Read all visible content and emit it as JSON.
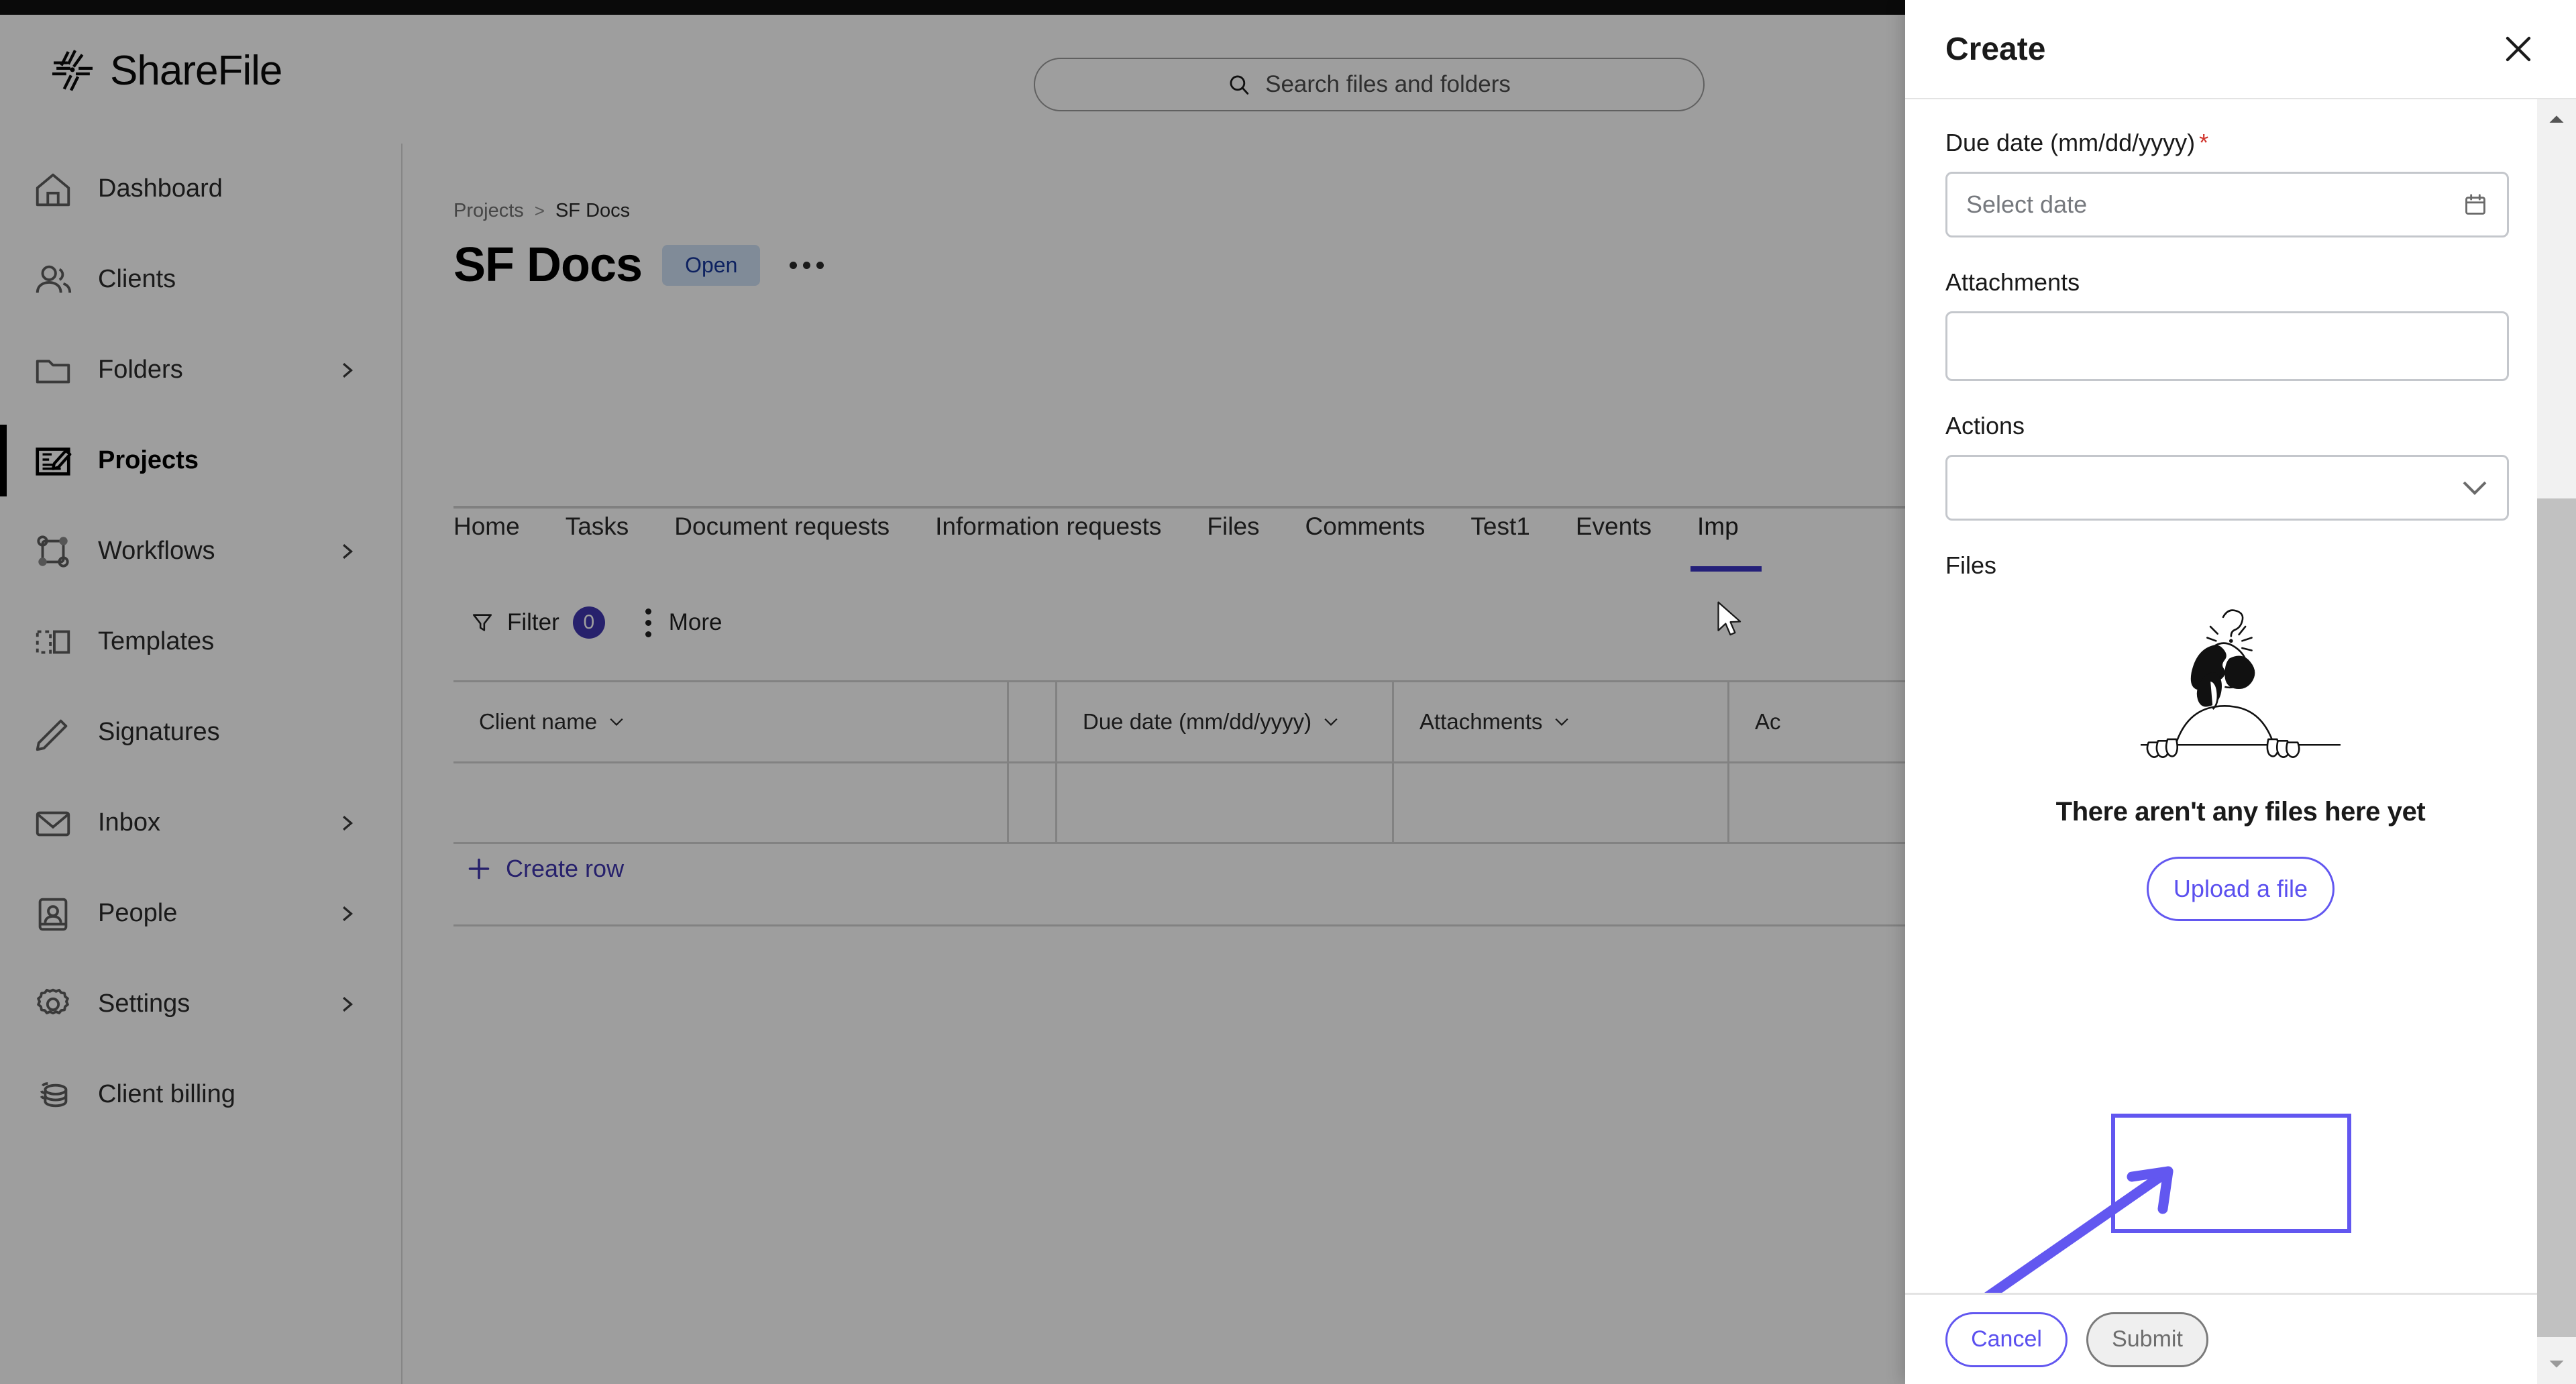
{
  "app": {
    "brand_name": "ShareFile",
    "brand_logo_icon": "sharefile-starburst-icon",
    "accent_purple": "#3f36ae",
    "annotation_purple": "#6257f0",
    "status_badge_bg": "#cfe0f5",
    "status_badge_text_color": "#15369b"
  },
  "search": {
    "placeholder": "Search files and folders",
    "icon": "search-icon"
  },
  "sidebar": {
    "items": [
      {
        "label": "Dashboard",
        "icon": "home-icon",
        "has_chevron": false,
        "active": false
      },
      {
        "label": "Clients",
        "icon": "people-icon",
        "has_chevron": false,
        "active": false
      },
      {
        "label": "Folders",
        "icon": "folder-icon",
        "has_chevron": true,
        "active": false
      },
      {
        "label": "Projects",
        "icon": "projects-icon",
        "has_chevron": false,
        "active": true
      },
      {
        "label": "Workflows",
        "icon": "workflow-icon",
        "has_chevron": true,
        "active": false
      },
      {
        "label": "Templates",
        "icon": "templates-icon",
        "has_chevron": false,
        "active": false
      },
      {
        "label": "Signatures",
        "icon": "signature-icon",
        "has_chevron": false,
        "active": false
      },
      {
        "label": "Inbox",
        "icon": "envelope-icon",
        "has_chevron": true,
        "active": false
      },
      {
        "label": "People",
        "icon": "address-book-icon",
        "has_chevron": true,
        "active": false
      },
      {
        "label": "Settings",
        "icon": "gear-icon",
        "has_chevron": true,
        "active": false
      },
      {
        "label": "Client billing",
        "icon": "coins-icon",
        "has_chevron": false,
        "active": false
      }
    ]
  },
  "main": {
    "breadcrumb": {
      "parent": "Projects",
      "separator": ">",
      "current": "SF Docs"
    },
    "page_title": "SF Docs",
    "status_badge": "Open",
    "more_menu_icon": "ellipsis-horizontal-icon",
    "tabs": [
      {
        "label": "Home",
        "active": false
      },
      {
        "label": "Tasks",
        "active": false
      },
      {
        "label": "Document requests",
        "active": false
      },
      {
        "label": "Information requests",
        "active": false
      },
      {
        "label": "Files",
        "active": false
      },
      {
        "label": "Comments",
        "active": false
      },
      {
        "label": "Test1",
        "active": false
      },
      {
        "label": "Events",
        "active": false
      },
      {
        "label": "Imp",
        "active": true
      }
    ],
    "toolbar": {
      "filter_label": "Filter",
      "filter_count": "0",
      "more_label": "More"
    },
    "table": {
      "columns": [
        {
          "label": "Client name",
          "sortable": true
        },
        {
          "label": "",
          "sortable": false
        },
        {
          "label": "Due date (mm/dd/yyyy)",
          "sortable": true
        },
        {
          "label": "Attachments",
          "sortable": true
        },
        {
          "label": "Ac",
          "sortable": true
        }
      ],
      "rows": [
        {
          "client_name": "",
          "spacer": "",
          "due_date": "",
          "attachments": "",
          "actions": ""
        }
      ]
    },
    "create_row_label": "Create row"
  },
  "panel": {
    "title": "Create",
    "close_icon": "close-icon",
    "fields": {
      "due_date": {
        "label": "Due date (mm/dd/yyyy)",
        "required_marker": "*",
        "placeholder": "Select date",
        "value": "",
        "icon": "calendar-icon"
      },
      "attachments": {
        "label": "Attachments",
        "value": ""
      },
      "actions": {
        "label": "Actions",
        "value": "",
        "icon": "chevron-down-icon"
      }
    },
    "files": {
      "label": "Files",
      "empty_illustration": "person-peeking-question-mark-icon",
      "empty_title": "There aren't any files here yet",
      "upload_button": "Upload a file"
    },
    "footer": {
      "cancel_label": "Cancel",
      "submit_label": "Submit"
    }
  }
}
